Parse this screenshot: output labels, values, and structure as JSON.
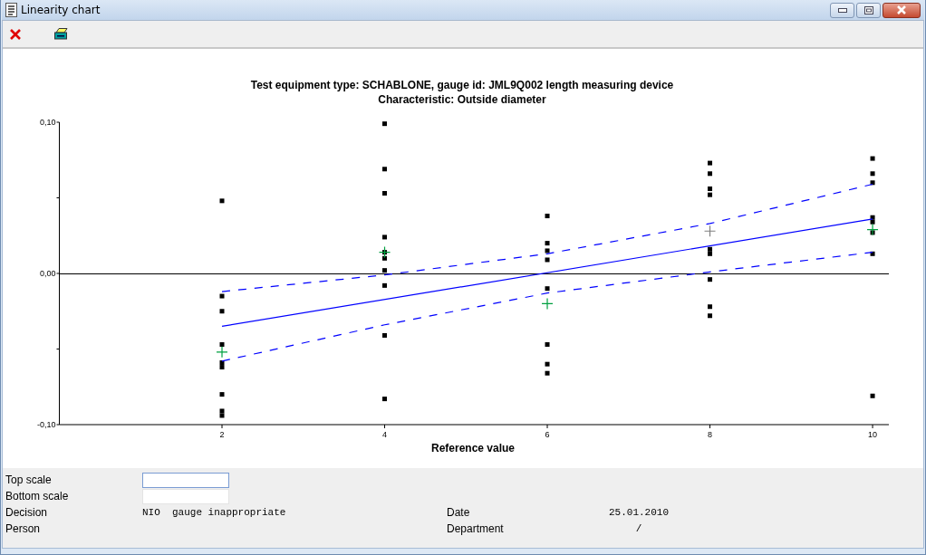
{
  "window": {
    "title": "Linearity chart"
  },
  "chart": {
    "title_lines": [
      "Test equipment type: SCHABLONE, gauge id: JML9Q002 length measuring device",
      "Characteristic: Outside diameter"
    ],
    "chart_data": {
      "type": "scatter",
      "xlabel": "Reference value",
      "xlim": [
        0,
        10.2
      ],
      "ylim": [
        -0.1,
        0.1
      ],
      "xticks": [
        2,
        4,
        6,
        8,
        10
      ],
      "yticks": [
        {
          "value": 0.1,
          "label": "0,10"
        },
        {
          "value": 0,
          "label": "0,00"
        },
        {
          "value": -0.1,
          "label": "-0,10"
        }
      ],
      "series": [
        {
          "type": "scatter",
          "marker": "square",
          "color": "#000000",
          "x": [
            2,
            2,
            2,
            2,
            2,
            2,
            2,
            2,
            2,
            4,
            4,
            4,
            4,
            4,
            4,
            4,
            4,
            4,
            4,
            6,
            6,
            6,
            6,
            6,
            6,
            6,
            6,
            8,
            8,
            8,
            8,
            8,
            8,
            8,
            8,
            8,
            10,
            10,
            10,
            10,
            10,
            10,
            10,
            10
          ],
          "values": [
            0.048,
            -0.015,
            -0.025,
            -0.047,
            -0.059,
            -0.062,
            -0.08,
            -0.091,
            -0.094,
            0.099,
            0.069,
            0.053,
            0.024,
            0.014,
            0.01,
            0.002,
            -0.008,
            -0.041,
            -0.083,
            0.038,
            0.02,
            0.015,
            0.009,
            -0.01,
            -0.047,
            -0.06,
            -0.066,
            0.073,
            0.066,
            0.056,
            0.052,
            0.016,
            0.013,
            -0.004,
            -0.022,
            -0.028,
            0.076,
            0.066,
            0.06,
            0.037,
            0.034,
            0.027,
            0.013,
            -0.081
          ]
        },
        {
          "type": "scatter",
          "marker": "cross",
          "color": "#00a040",
          "x": [
            2,
            4,
            6,
            10
          ],
          "values": [
            -0.052,
            0.014,
            -0.02,
            0.029
          ]
        },
        {
          "type": "scatter",
          "marker": "cross",
          "color": "#808080",
          "x": [
            8
          ],
          "values": [
            0.028
          ]
        },
        {
          "type": "line",
          "line_style": "solid",
          "color": "#0000ff",
          "x": [
            2,
            10
          ],
          "values": [
            -0.035,
            0.036
          ]
        },
        {
          "type": "line",
          "line_style": "dashed",
          "color": "#0000ff",
          "x": [
            2,
            4,
            6,
            8,
            10
          ],
          "values": [
            -0.012,
            -0.001,
            0.013,
            0.033,
            0.059
          ]
        },
        {
          "type": "line",
          "line_style": "dashed",
          "color": "#0000ff",
          "x": [
            2,
            4,
            6,
            8,
            10
          ],
          "values": [
            -0.058,
            -0.034,
            -0.013,
            0.001,
            0.014
          ]
        }
      ]
    }
  },
  "fields": [
    {
      "label": "Top scale",
      "kind": "input",
      "focused": true
    },
    {
      "label": "Bottom scale",
      "kind": "input",
      "focused": false
    },
    {
      "label": "Decision",
      "kind": "text",
      "value": "NIO  gauge inappropriate"
    },
    {
      "label": "Person",
      "kind": "text"
    }
  ],
  "right_fields": [
    {
      "label": "Date",
      "value": "25.01.2010"
    },
    {
      "label": "Department",
      "value": "/"
    }
  ]
}
